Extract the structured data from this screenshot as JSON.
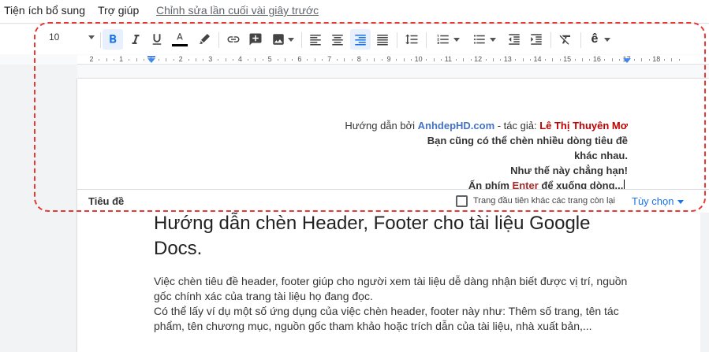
{
  "menubar": {
    "items": [
      "Tiện ích bổ sung",
      "Trợ giúp"
    ],
    "last_edit": "Chỉnh sửa lần cuối vài giây trước"
  },
  "toolbar": {
    "font_size": "10",
    "accent_color": "#1a73e8"
  },
  "ruler": {
    "numbers": [
      "2",
      "1",
      "1",
      "2",
      "3",
      "4",
      "5",
      "6",
      "7",
      "8",
      "9",
      "10",
      "11",
      "12",
      "13",
      "14",
      "15",
      "16",
      "17",
      "18"
    ]
  },
  "header": {
    "line1_prefix": "Hướng dẫn bởi ",
    "line1_site": "AnhdepHD.com",
    "line1_mid": " - tác giả: ",
    "line1_author": "Lê Thị Thuyên Mơ",
    "line2": "Bạn cũng có thể chèn nhiều dòng tiêu đề",
    "line3": "khác nhau.",
    "line4": "Như thế này chẳng hạn!",
    "line5_prefix": "Ấn phím ",
    "line5_key": "Enter",
    "line5_suffix": " để xuống dòng...",
    "bar_label": "Tiêu đề",
    "checkbox_label": "Trang đầu tiên khác các trang còn lại",
    "options_label": "Tùy chọn"
  },
  "document": {
    "title": "Hướng dẫn chèn Header, Footer cho tài liệu Google Docs.",
    "paragraph1": "Việc chèn tiêu đề header, footer giúp cho người xem tài liệu dễ dàng nhận biết được vị trí, nguồn gốc chính xác của trang tài liệu họ đang đọc.",
    "paragraph2": "Có thể lấy ví dụ một số ứng dụng của việc chèn header, footer này như: Thêm số trang, tên tác phẩm, tên chương mục, nguồn gốc tham khảo hoặc trích dẫn của tài liệu, nhà xuất bản,..."
  }
}
